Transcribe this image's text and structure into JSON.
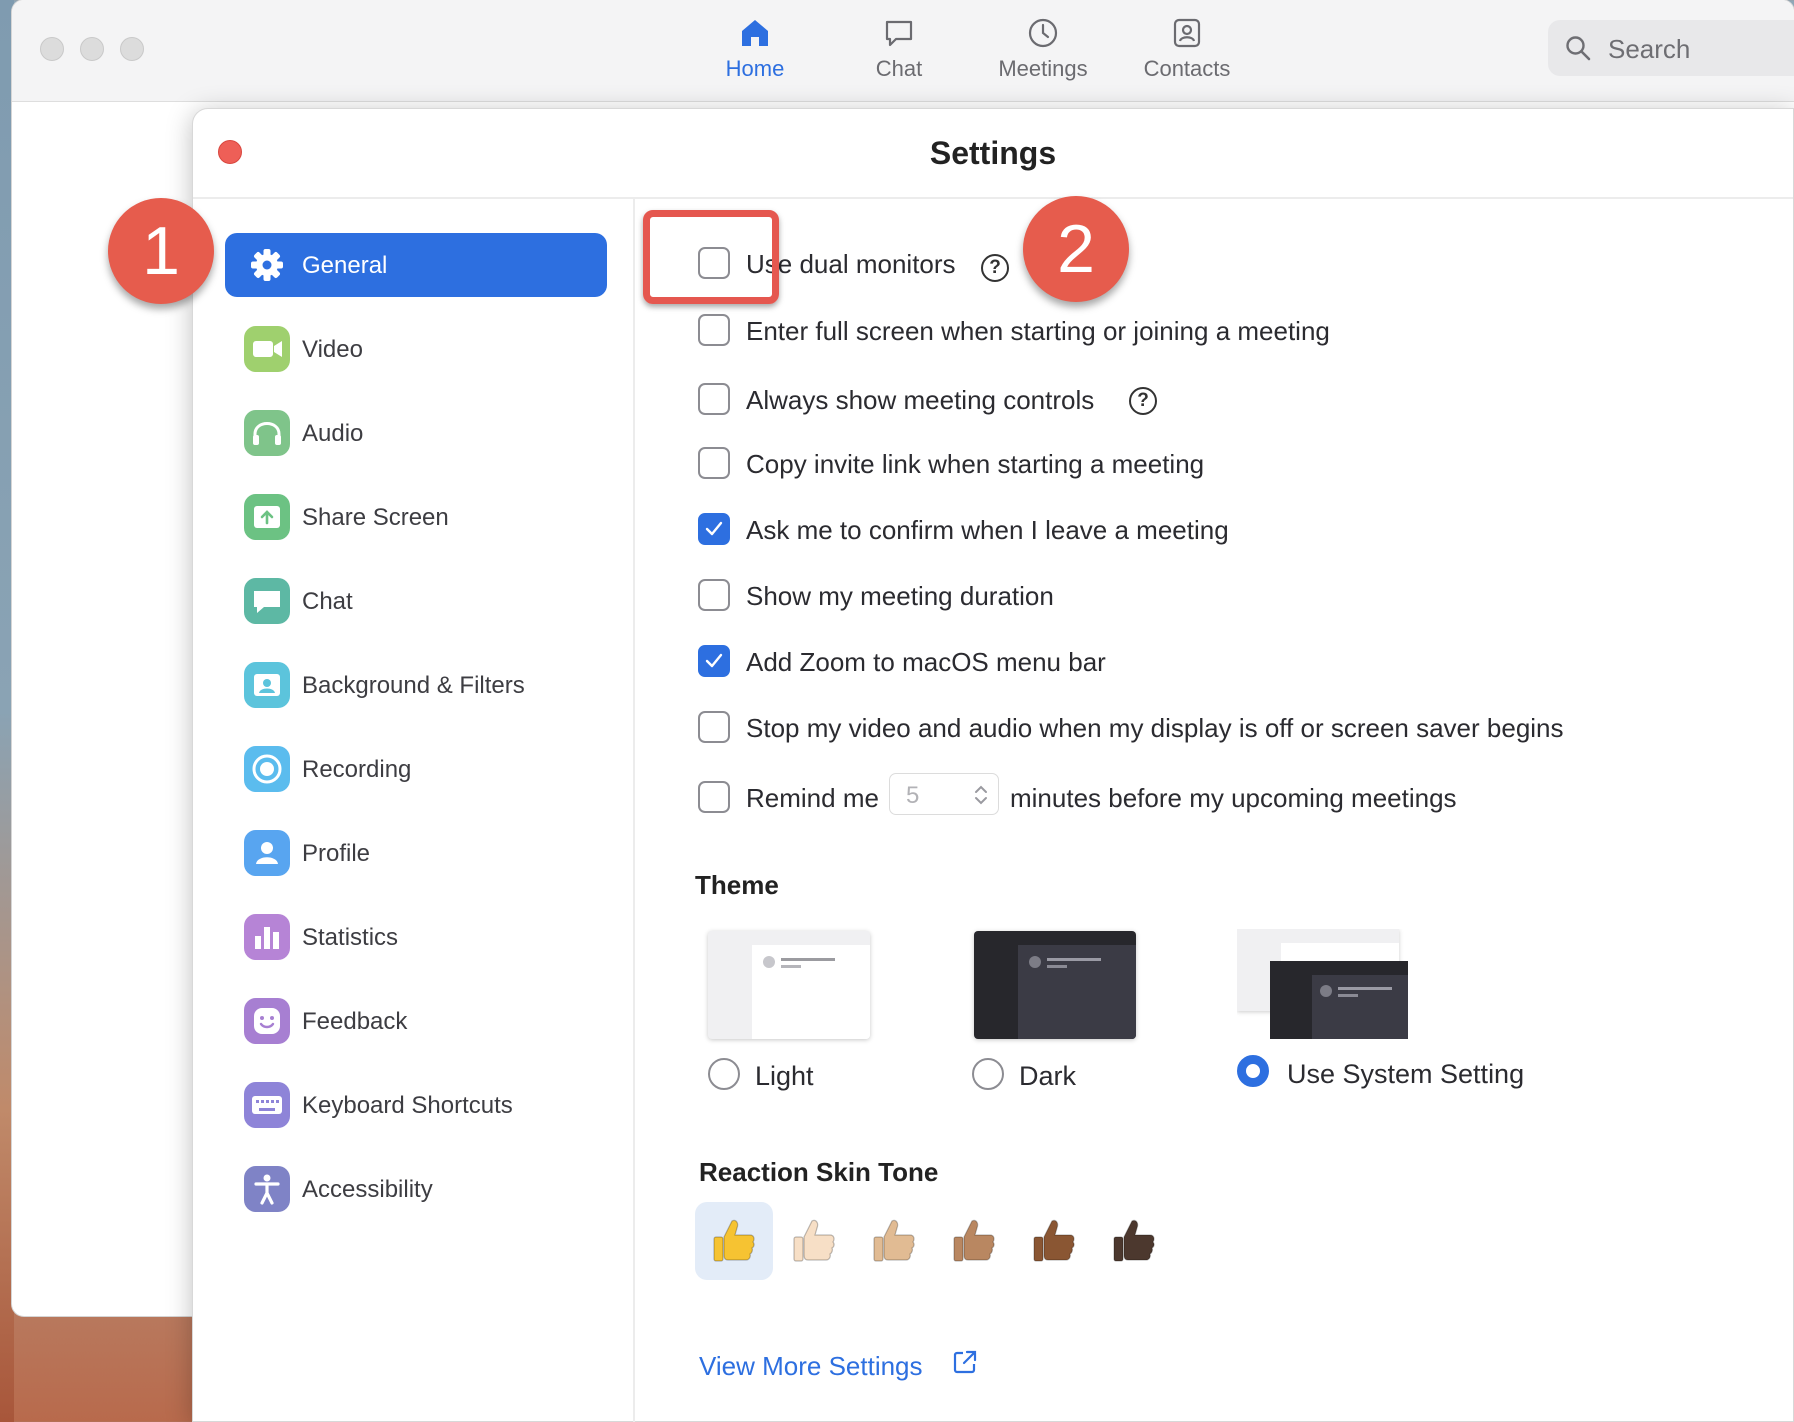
{
  "main_tabs": [
    {
      "label": "Home",
      "icon": "home-icon",
      "active": true
    },
    {
      "label": "Chat",
      "icon": "chat-bubble-icon",
      "active": false
    },
    {
      "label": "Meetings",
      "icon": "clock-icon",
      "active": false
    },
    {
      "label": "Contacts",
      "icon": "contacts-icon",
      "active": false
    }
  ],
  "search": {
    "placeholder": "Search"
  },
  "settings": {
    "title": "Settings",
    "sidebar": [
      {
        "label": "General",
        "icon": "gear-icon",
        "color": "#2d6fe0",
        "active": true
      },
      {
        "label": "Video",
        "icon": "video-camera-icon",
        "color": "#9fd06e"
      },
      {
        "label": "Audio",
        "icon": "headphones-icon",
        "color": "#7fc48a"
      },
      {
        "label": "Share Screen",
        "icon": "share-screen-icon",
        "color": "#6cc283"
      },
      {
        "label": "Chat",
        "icon": "chat-icon",
        "color": "#5db8a4"
      },
      {
        "label": "Background & Filters",
        "icon": "background-icon",
        "color": "#5cc4dc"
      },
      {
        "label": "Recording",
        "icon": "record-icon",
        "color": "#5bbcee"
      },
      {
        "label": "Profile",
        "icon": "profile-icon",
        "color": "#58a5f0"
      },
      {
        "label": "Statistics",
        "icon": "statistics-icon",
        "color": "#b684d6"
      },
      {
        "label": "Feedback",
        "icon": "feedback-icon",
        "color": "#a77fd2"
      },
      {
        "label": "Keyboard Shortcuts",
        "icon": "keyboard-icon",
        "color": "#8e84d8"
      },
      {
        "label": "Accessibility",
        "icon": "accessibility-icon",
        "color": "#7f83c6"
      }
    ],
    "options": [
      {
        "label": "Use dual monitors",
        "checked": false,
        "help": true
      },
      {
        "label": "Enter full screen when starting or joining a meeting",
        "checked": false
      },
      {
        "label": "Always show meeting controls",
        "checked": false,
        "help": true
      },
      {
        "label": "Copy invite link when starting a meeting",
        "checked": false
      },
      {
        "label": "Ask me to confirm when I leave a meeting",
        "checked": true
      },
      {
        "label": "Show my meeting duration",
        "checked": false
      },
      {
        "label": "Add Zoom to macOS menu bar",
        "checked": true
      },
      {
        "label": "Stop my video and audio when my display is off or screen saver begins",
        "checked": false
      }
    ],
    "help_glyph": "?",
    "remind": {
      "checked": false,
      "prefix": "Remind me",
      "value": "5",
      "suffix": "minutes before my upcoming meetings"
    },
    "theme": {
      "heading": "Theme",
      "options": [
        {
          "label": "Light",
          "selected": false
        },
        {
          "label": "Dark",
          "selected": false
        },
        {
          "label": "Use System Setting",
          "selected": true
        }
      ]
    },
    "skin_tone": {
      "heading": "Reaction Skin Tone",
      "tones": [
        "#f6c332",
        "#f7dfc6",
        "#e1bb93",
        "#b98761",
        "#8a5633",
        "#4c382e"
      ],
      "selected_index": 0
    },
    "view_more": "View More Settings"
  },
  "annotations": {
    "step1": "1",
    "step2": "2",
    "color": "#e65c4d"
  }
}
